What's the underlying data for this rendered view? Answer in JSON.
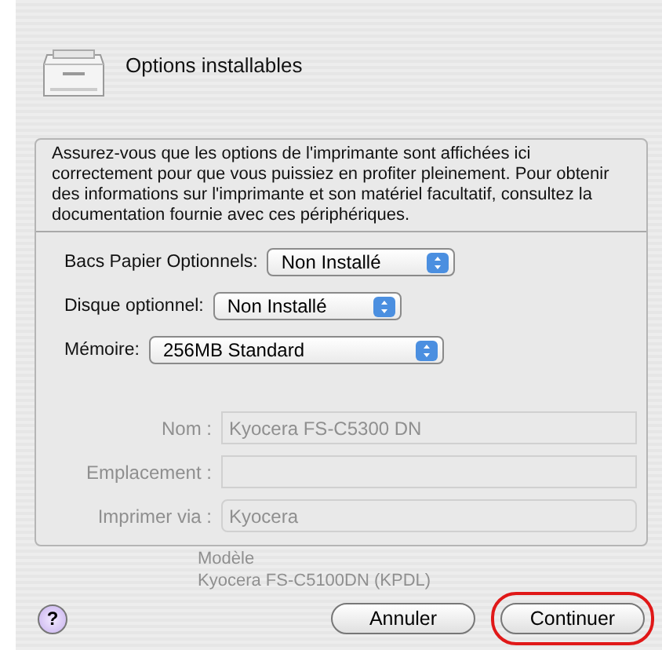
{
  "sheet": {
    "title": "Options installables",
    "description": "Assurez-vous que les options de l'imprimante sont affichées ici correctement pour que vous puissiez en profiter pleinement. Pour obtenir des informations sur l'imprimante et son matériel facultatif, consultez la documentation fournie avec ces périphériques.",
    "options": [
      {
        "label": "Bacs Papier Optionnels:",
        "value": "Non Installé"
      },
      {
        "label": "Disque optionnel:",
        "value": "Non Installé"
      },
      {
        "label": "Mémoire:",
        "value": "256MB Standard"
      }
    ],
    "help_label": "?",
    "buttons": [
      {
        "label": "Annuler",
        "highlighted": false
      },
      {
        "label": "Continuer",
        "highlighted": true
      }
    ]
  },
  "background": {
    "fields": [
      {
        "label": "Nom :",
        "value": "Kyocera FS-C5300 DN",
        "kind": "text"
      },
      {
        "label": "Emplacement :",
        "kind": "text"
      },
      {
        "label": "Imprimer via :",
        "value": "Kyocera",
        "kind": "popup"
      }
    ],
    "model_list": [
      "Modèle",
      "Kyocera FS-C5100DN (KPDL)"
    ]
  }
}
